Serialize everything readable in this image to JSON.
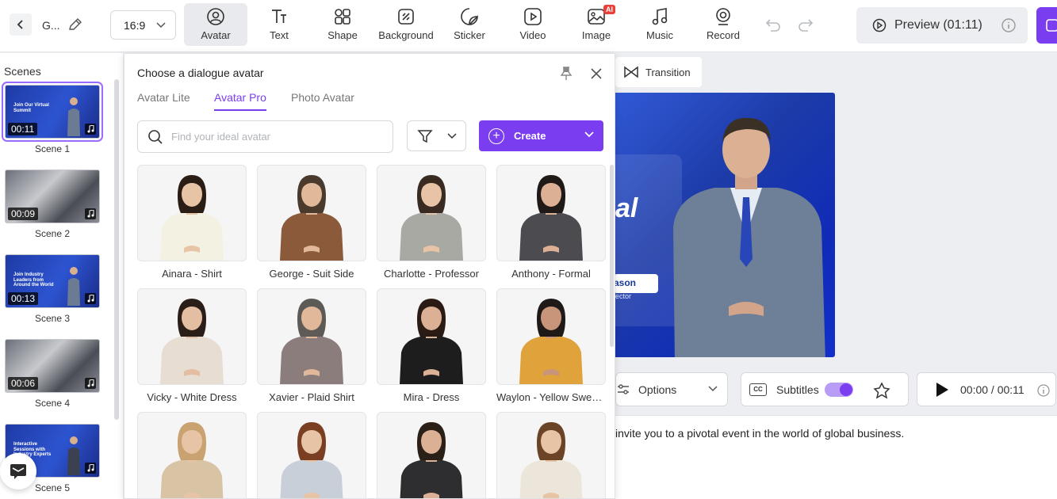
{
  "toolbar": {
    "project_name": "G...",
    "aspect_ratio": "16:9",
    "tools": [
      {
        "label": "Avatar",
        "icon": "avatar-icon",
        "active": true
      },
      {
        "label": "Text",
        "icon": "text-icon"
      },
      {
        "label": "Shape",
        "icon": "shape-icon"
      },
      {
        "label": "Background",
        "icon": "background-icon"
      },
      {
        "label": "Sticker",
        "icon": "sticker-icon"
      },
      {
        "label": "Video",
        "icon": "video-icon"
      },
      {
        "label": "Image",
        "icon": "image-icon",
        "badge": "AI"
      },
      {
        "label": "Music",
        "icon": "music-icon"
      },
      {
        "label": "Record",
        "icon": "record-icon"
      }
    ],
    "preview_label": "Preview (01:11)",
    "accent": "#7b3df0"
  },
  "scenes": {
    "title": "Scenes",
    "items": [
      {
        "label": "Scene 1",
        "duration": "00:11",
        "thumb_text": "Join Our Virtual Summit",
        "selected": true
      },
      {
        "label": "Scene 2",
        "duration": "00:09",
        "thumb_text": ""
      },
      {
        "label": "Scene 3",
        "duration": "00:13",
        "thumb_text": "Join Industry Leaders from Around the World"
      },
      {
        "label": "Scene 4",
        "duration": "00:06",
        "thumb_text": ""
      },
      {
        "label": "Scene 5",
        "duration": "",
        "thumb_text": "Interactive Sessions with Industry Experts"
      }
    ]
  },
  "dialog": {
    "title": "Choose a dialogue avatar",
    "tabs": [
      {
        "label": "Avatar Lite",
        "active": false
      },
      {
        "label": "Avatar Pro",
        "active": true
      },
      {
        "label": "Photo Avatar",
        "active": false
      }
    ],
    "search_placeholder": "Find your ideal avatar",
    "create_label": "Create",
    "avatars": [
      {
        "name": "Ainara - Shirt",
        "top": "#f3f1e2",
        "skin": "#e8c4a6",
        "hair": "#2a1d16"
      },
      {
        "name": "George - Suit Side",
        "top": "#8a5a3b",
        "skin": "#e2b89a",
        "hair": "#4a3a2e"
      },
      {
        "name": "Charlotte - Professor",
        "top": "#a9a9a4",
        "skin": "#e8c4a6",
        "hair": "#3a2b22"
      },
      {
        "name": "Anthony - Formal",
        "top": "#4b4b50",
        "skin": "#dcb094",
        "hair": "#1f1a17"
      },
      {
        "name": "Vicky - White Dress",
        "top": "#e8ddd2",
        "skin": "#e4bea2",
        "hair": "#2b1e18"
      },
      {
        "name": "Xavier - Plaid Shirt",
        "top": "#8c7d7d",
        "skin": "#e2b89a",
        "hair": "#5e5a56"
      },
      {
        "name": "Mira - Dress",
        "top": "#1d1d1d",
        "skin": "#dcb094",
        "hair": "#2a1c15"
      },
      {
        "name": "Waylon - Yellow Sweater",
        "top": "#e0a23a",
        "skin": "#c9957a",
        "hair": "#1f1a17"
      },
      {
        "name": "",
        "top": "#d9c3a5",
        "skin": "#e8c4a6",
        "hair": "#c9a271"
      },
      {
        "name": "",
        "top": "#c9cfd8",
        "skin": "#e8c4a6",
        "hair": "#7a3f22"
      },
      {
        "name": "",
        "top": "#2e2e31",
        "skin": "#dcb094",
        "hair": "#2b2018"
      },
      {
        "name": "",
        "top": "#ece6da",
        "skin": "#e8c4a6",
        "hair": "#6b4428"
      }
    ]
  },
  "canvas": {
    "transition_label": "Transition",
    "title_fragment": "al",
    "name_pill": "ason",
    "role_fragment": "ector"
  },
  "controls": {
    "options_label": "Options",
    "subtitles_label": "Subtitles",
    "subtitles_on": true,
    "time": "00:00 / 00:11",
    "script_text": "invite you to a pivotal event in the world of global business."
  }
}
